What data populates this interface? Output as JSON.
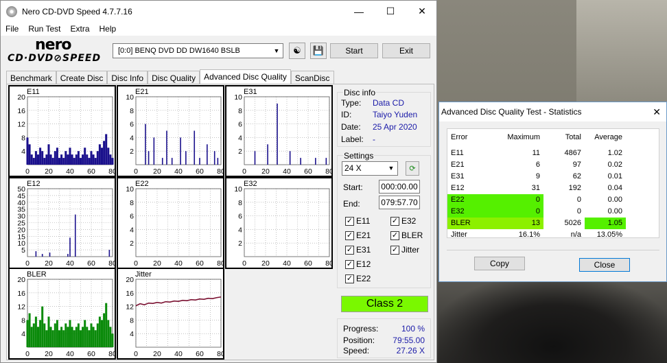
{
  "window": {
    "title": "Nero CD-DVD Speed 4.7.7.16"
  },
  "menu": [
    "File",
    "Run Test",
    "Extra",
    "Help"
  ],
  "toolbar": {
    "drive": "[0:0]  BENQ DVD DD DW1640 BSLB",
    "start": "Start",
    "exit": "Exit"
  },
  "logo": {
    "brand": "nero",
    "sub": "CD·DVD⊘SPEED"
  },
  "tabs": [
    "Benchmark",
    "Create Disc",
    "Disc Info",
    "Disc Quality",
    "Advanced Disc Quality",
    "ScanDisc"
  ],
  "disc_info": {
    "caption": "Disc info",
    "type_label": "Type:",
    "type": "Data CD",
    "id_label": "ID:",
    "id": "Taiyo Yuden",
    "date_label": "Date:",
    "date": "25 Apr 2020",
    "label_label": "Label:",
    "label": "-"
  },
  "settings": {
    "caption": "Settings",
    "speed": "24 X",
    "start_label": "Start:",
    "start": "000:00.00",
    "end_label": "End:",
    "end": "079:57.70"
  },
  "checks": [
    "E11",
    "E21",
    "E31",
    "E12",
    "E22",
    "E32",
    "BLER",
    "Jitter"
  ],
  "class_label": "Class 2",
  "progress": {
    "progress_label": "Progress:",
    "progress": "100 %",
    "position_label": "Position:",
    "position": "79:55.00",
    "speed_label": "Speed:",
    "speed": "27.26 X"
  },
  "chart_data": [
    {
      "type": "bar",
      "title": "E11",
      "ylim": [
        0,
        20
      ],
      "yticks": [
        4,
        8,
        12,
        16,
        20
      ],
      "xticks": [
        0,
        20,
        40,
        60,
        80
      ],
      "x": [
        0,
        2,
        4,
        6,
        8,
        10,
        12,
        14,
        16,
        18,
        20,
        22,
        24,
        26,
        28,
        30,
        32,
        34,
        36,
        38,
        40,
        42,
        44,
        46,
        48,
        50,
        52,
        54,
        56,
        58,
        60,
        62,
        64,
        66,
        68,
        70,
        72,
        74,
        76,
        78,
        80
      ],
      "values": [
        8,
        6,
        3,
        2,
        4,
        3,
        5,
        4,
        2,
        3,
        6,
        3,
        2,
        4,
        5,
        2,
        3,
        2,
        4,
        3,
        5,
        3,
        2,
        3,
        4,
        2,
        3,
        5,
        3,
        2,
        4,
        3,
        2,
        4,
        6,
        5,
        7,
        9,
        5,
        3,
        2
      ]
    },
    {
      "type": "bar",
      "title": "E21",
      "ylim": [
        0,
        10
      ],
      "yticks": [
        2,
        4,
        6,
        8,
        10
      ],
      "xticks": [
        0,
        20,
        40,
        60,
        80
      ],
      "x": [
        9,
        12,
        17,
        25,
        29,
        34,
        42,
        47,
        55,
        60,
        67,
        74,
        77
      ],
      "values": [
        6,
        2,
        4,
        1,
        5,
        1,
        4,
        2,
        5,
        1,
        3,
        2,
        1
      ]
    },
    {
      "type": "bar",
      "title": "E31",
      "ylim": [
        0,
        10
      ],
      "yticks": [
        2,
        4,
        6,
        8,
        10
      ],
      "xticks": [
        0,
        20,
        40,
        60,
        80
      ],
      "x": [
        10,
        22,
        31,
        43,
        53,
        67,
        77
      ],
      "values": [
        2,
        3,
        9,
        2,
        1,
        1,
        1
      ]
    },
    {
      "type": "bar",
      "title": "E12",
      "ylim": [
        0,
        50
      ],
      "yticks": [
        5,
        10,
        15,
        20,
        25,
        30,
        35,
        40,
        45,
        50
      ],
      "xticks": [
        0,
        20,
        40,
        60,
        80
      ],
      "x": [
        8,
        14,
        21,
        38,
        40,
        45,
        77
      ],
      "values": [
        4,
        2,
        3,
        2,
        14,
        31,
        5
      ]
    },
    {
      "type": "bar",
      "title": "E22",
      "ylim": [
        0,
        10
      ],
      "yticks": [
        2,
        4,
        6,
        8,
        10
      ],
      "xticks": [
        0,
        20,
        40,
        60,
        80
      ],
      "x": [],
      "values": []
    },
    {
      "type": "bar",
      "title": "E32",
      "ylim": [
        0,
        10
      ],
      "yticks": [
        2,
        4,
        6,
        8,
        10
      ],
      "xticks": [
        0,
        20,
        40,
        60,
        80
      ],
      "x": [],
      "values": []
    },
    {
      "type": "bar",
      "title": "BLER",
      "ylim": [
        0,
        20
      ],
      "yticks": [
        4,
        8,
        12,
        16,
        20
      ],
      "xticks": [
        0,
        20,
        40,
        60,
        80
      ],
      "x": [
        0,
        2,
        4,
        6,
        8,
        10,
        12,
        14,
        16,
        18,
        20,
        22,
        24,
        26,
        28,
        30,
        32,
        34,
        36,
        38,
        40,
        42,
        44,
        46,
        48,
        50,
        52,
        54,
        56,
        58,
        60,
        62,
        64,
        66,
        68,
        70,
        72,
        74,
        76,
        78,
        80
      ],
      "values": [
        8,
        10,
        6,
        7,
        9,
        6,
        8,
        12,
        7,
        5,
        9,
        6,
        5,
        7,
        8,
        5,
        6,
        5,
        7,
        6,
        8,
        6,
        5,
        6,
        7,
        5,
        6,
        8,
        6,
        5,
        7,
        6,
        5,
        7,
        9,
        8,
        10,
        13,
        8,
        6,
        4
      ]
    },
    {
      "type": "line",
      "title": "Jitter",
      "ylim": [
        0,
        20
      ],
      "yticks": [
        4,
        8,
        12,
        16,
        20
      ],
      "xticks": [
        0,
        20,
        40,
        60,
        80
      ],
      "x": [
        0,
        4,
        8,
        12,
        16,
        20,
        24,
        28,
        32,
        36,
        40,
        44,
        48,
        52,
        56,
        60,
        64,
        68,
        72,
        76,
        80
      ],
      "values": [
        12.2,
        12.8,
        12.5,
        13.0,
        12.9,
        13.2,
        13.0,
        13.4,
        13.3,
        13.6,
        13.5,
        13.8,
        13.7,
        14.0,
        13.9,
        14.2,
        14.1,
        14.4,
        14.3,
        14.6,
        14.8
      ]
    }
  ],
  "stats": {
    "title": "Advanced Disc Quality Test - Statistics",
    "headers": [
      "Error",
      "Maximum",
      "Total",
      "Average"
    ],
    "rows": [
      {
        "name": "E11",
        "max": "11",
        "total": "4867",
        "avg": "1.02",
        "hl": ""
      },
      {
        "name": "E21",
        "max": "6",
        "total": "97",
        "avg": "0.02",
        "hl": ""
      },
      {
        "name": "E31",
        "max": "9",
        "total": "62",
        "avg": "0.01",
        "hl": ""
      },
      {
        "name": "E12",
        "max": "31",
        "total": "192",
        "avg": "0.04",
        "hl": ""
      },
      {
        "name": "E22",
        "max": "0",
        "total": "0",
        "avg": "0.00",
        "hl": "full"
      },
      {
        "name": "E32",
        "max": "0",
        "total": "0",
        "avg": "0.00",
        "hl": "full"
      },
      {
        "name": "BLER",
        "max": "13",
        "total": "5026",
        "avg": "1.05",
        "hl": "bler"
      },
      {
        "name": "Jitter",
        "max": "16.1%",
        "total": "n/a",
        "avg": "13.05%",
        "hl": ""
      }
    ],
    "copy": "Copy",
    "close": "Close"
  },
  "colors": {
    "bar": "#1a108c",
    "bler": "#0a8a0a",
    "jitter": "#7a1030",
    "class_bg": "#7af800",
    "hl": "#55f000"
  }
}
